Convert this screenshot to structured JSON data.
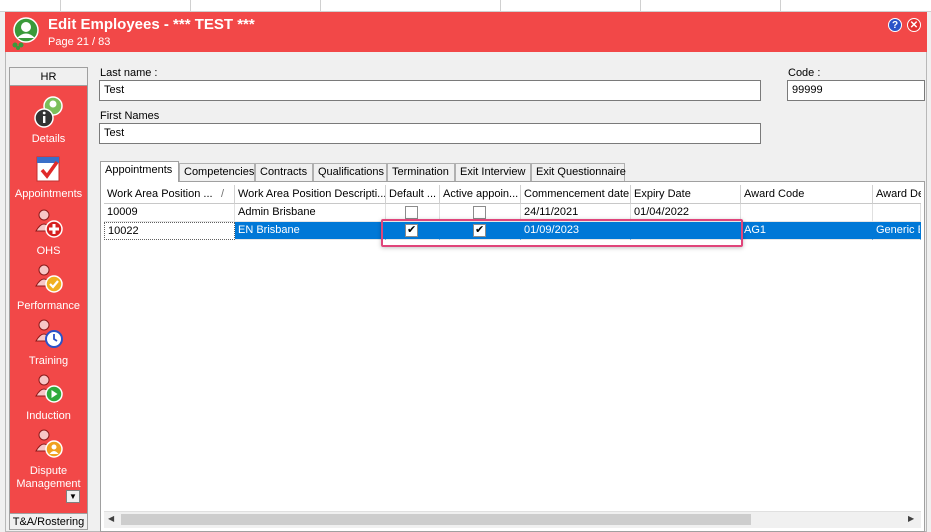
{
  "window": {
    "title": "Edit Employees - *** TEST ***",
    "subtitle": "Page 21 / 83",
    "help_glyph": "?",
    "close_glyph": "✕"
  },
  "sidebar": {
    "header": "HR",
    "items": [
      {
        "label": "Details",
        "icon": "details-icon"
      },
      {
        "label": "Appointments",
        "icon": "appointments-icon"
      },
      {
        "label": "OHS",
        "icon": "ohs-icon"
      },
      {
        "label": "Performance",
        "icon": "performance-icon"
      },
      {
        "label": "Training",
        "icon": "training-icon"
      },
      {
        "label": "Induction",
        "icon": "induction-icon"
      },
      {
        "label": "Dispute Management",
        "icon": "dispute-icon"
      }
    ],
    "footer": "T&A/Rostering"
  },
  "form": {
    "last_name_label": "Last name :",
    "last_name_value": "Test",
    "first_names_label": "First Names",
    "first_names_value": "Test",
    "code_label": "Code :",
    "code_value": "99999"
  },
  "tabs": [
    "Appointments",
    "Competencies",
    "Contracts",
    "Qualifications",
    "Termination",
    "Exit Interview",
    "Exit Questionnaire"
  ],
  "grid": {
    "columns": [
      "Work Area Position ...",
      "Work Area Position Descripti...",
      "Default ...",
      "Active appoin...",
      "Commencement date",
      "Expiry Date",
      "Award Code",
      "Award De"
    ],
    "sort_indicator": "/",
    "rows": [
      {
        "position": "10009",
        "description": "Admin Brisbane",
        "default": false,
        "active": false,
        "commencement": "24/11/2021",
        "expiry": "01/04/2022",
        "award_code": "",
        "award_desc": ""
      },
      {
        "position": "10022",
        "description": "EN Brisbane",
        "default": true,
        "active": true,
        "commencement": "01/09/2023",
        "expiry": "",
        "award_code": "AG1",
        "award_desc": "Generic E"
      }
    ],
    "selected_row": 1
  },
  "colors": {
    "titlebar": "#f24848",
    "selection": "#0078d7",
    "highlight": "#e0457b"
  }
}
